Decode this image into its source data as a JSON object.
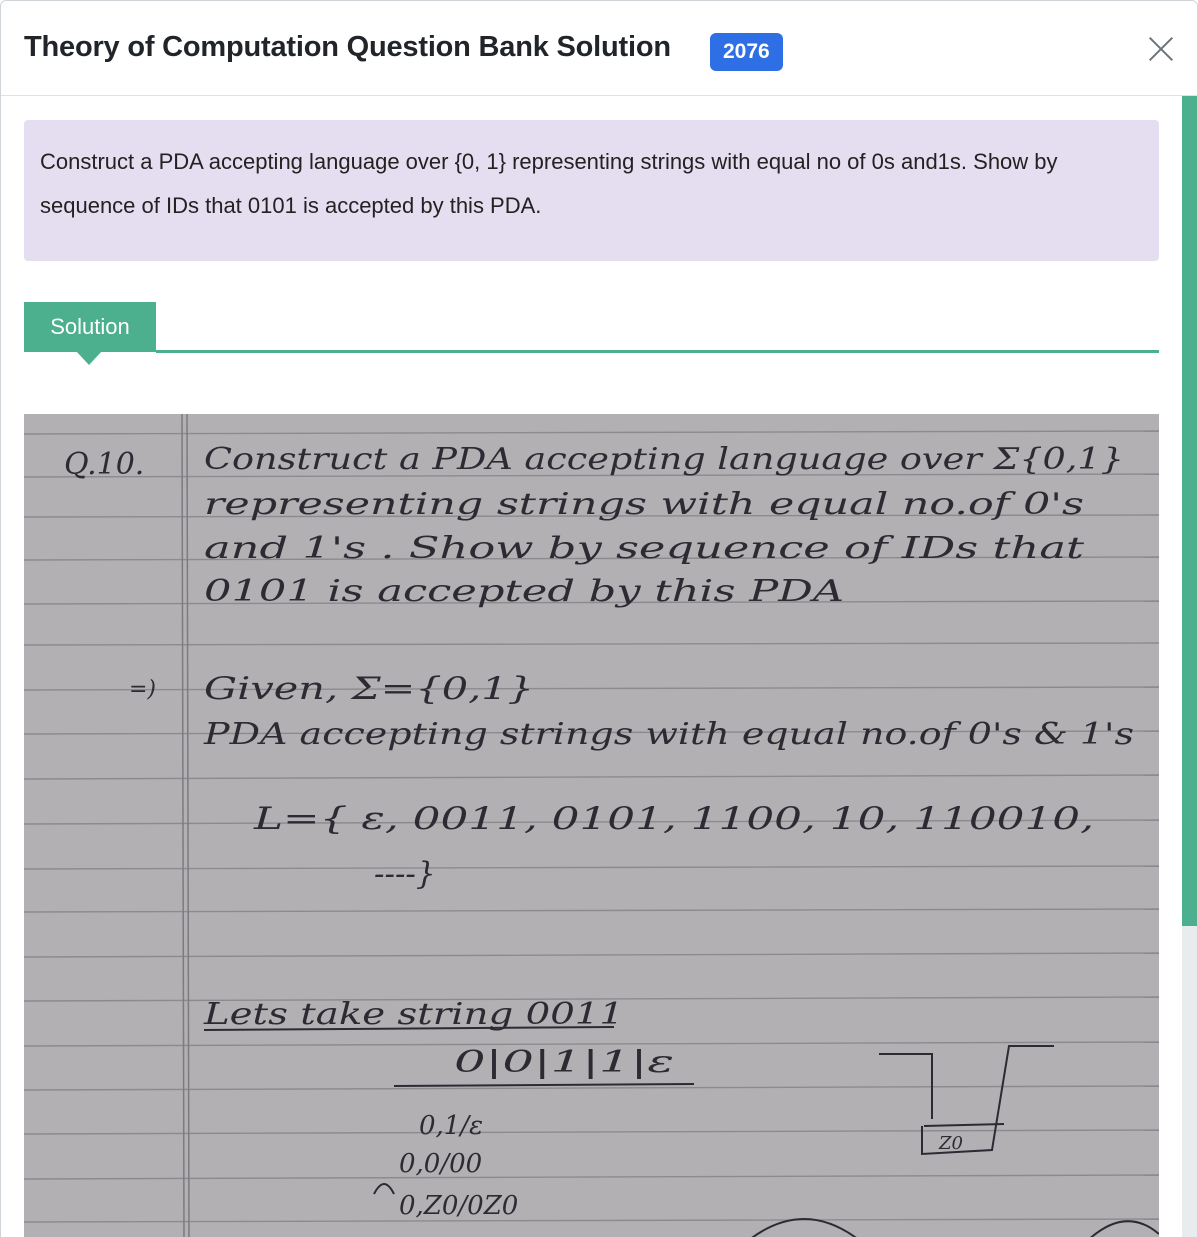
{
  "modal": {
    "title": "Theory of Computation Question Bank Solution",
    "year_badge": "2076"
  },
  "question": {
    "text": "Construct a PDA accepting language over {0, 1} representing strings with equal no of 0s and1s. Show by sequence of IDs that 0101 is accepted by this PDA."
  },
  "solution": {
    "tab_label": "Solution"
  },
  "handwritten_notes": {
    "q_label": "Q.10.",
    "lines": [
      "Construct a PDA accepting language over Σ{0,1}",
      "representing strings with equal no.of 0's",
      "and 1's . Show by sequence of IDs that",
      "0101 is accepted by this PDA"
    ],
    "answer_mark": "=)",
    "given": "Given, Σ={0,1}",
    "pda_line": "PDA accepting strings with equal no.of 0's & 1's",
    "language": "L={ ε, 0011, 0101, 1100, 10, 110010,",
    "language_cont": "----}",
    "take": "Lets take string 0011",
    "tape": "0|0|1|1|ε",
    "t1": "0,1/ε",
    "t2": "0,0/00",
    "t3": "0,Z0/0Z0",
    "stack_label": "Z0"
  },
  "colors": {
    "badge": "#2f6fe6",
    "accent": "#4caf8e",
    "question_bg": "#e5def0",
    "paper": "#b3b0b3",
    "ink": "#2c2a33"
  }
}
